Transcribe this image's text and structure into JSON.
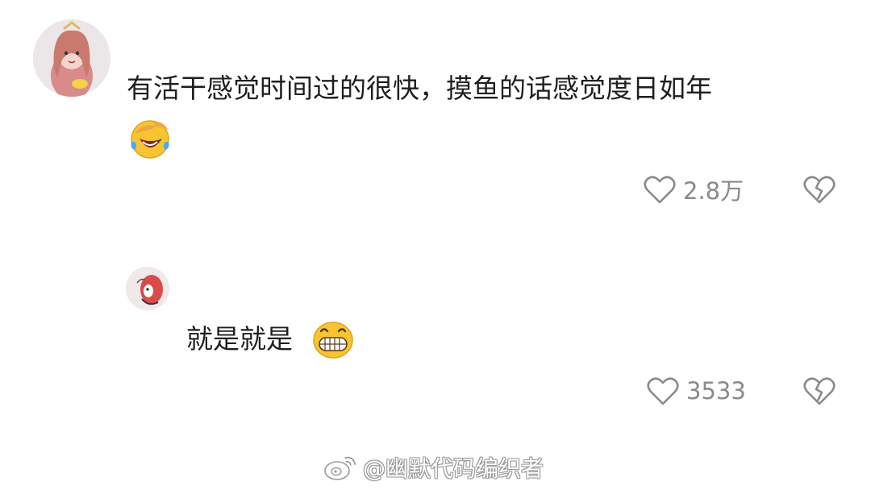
{
  "comments": [
    {
      "avatar_icon": "user-avatar-cartoon-girl",
      "text": "有活干感觉时间过的很快，摸鱼的话感觉度日如年",
      "emoji_icon": "laugh-cry-emoji",
      "likes": "2.8万",
      "like_icon": "heart-outline-icon",
      "dislike_icon": "broken-heart-icon"
    },
    {
      "avatar_icon": "user-avatar-cartoon",
      "text": "就是就是",
      "emoji_icon": "grinning-teeth-emoji",
      "likes": "3533",
      "like_icon": "heart-outline-icon",
      "dislike_icon": "broken-heart-icon",
      "is_reply": true
    }
  ],
  "watermark": {
    "icon": "weibo-logo-icon",
    "text": "@幽默代码编织者"
  },
  "colors": {
    "background": "#ffffff",
    "text": "#1f1f1f",
    "meta": "#8a8a8a",
    "emoji_yellow": "#f7c531"
  }
}
